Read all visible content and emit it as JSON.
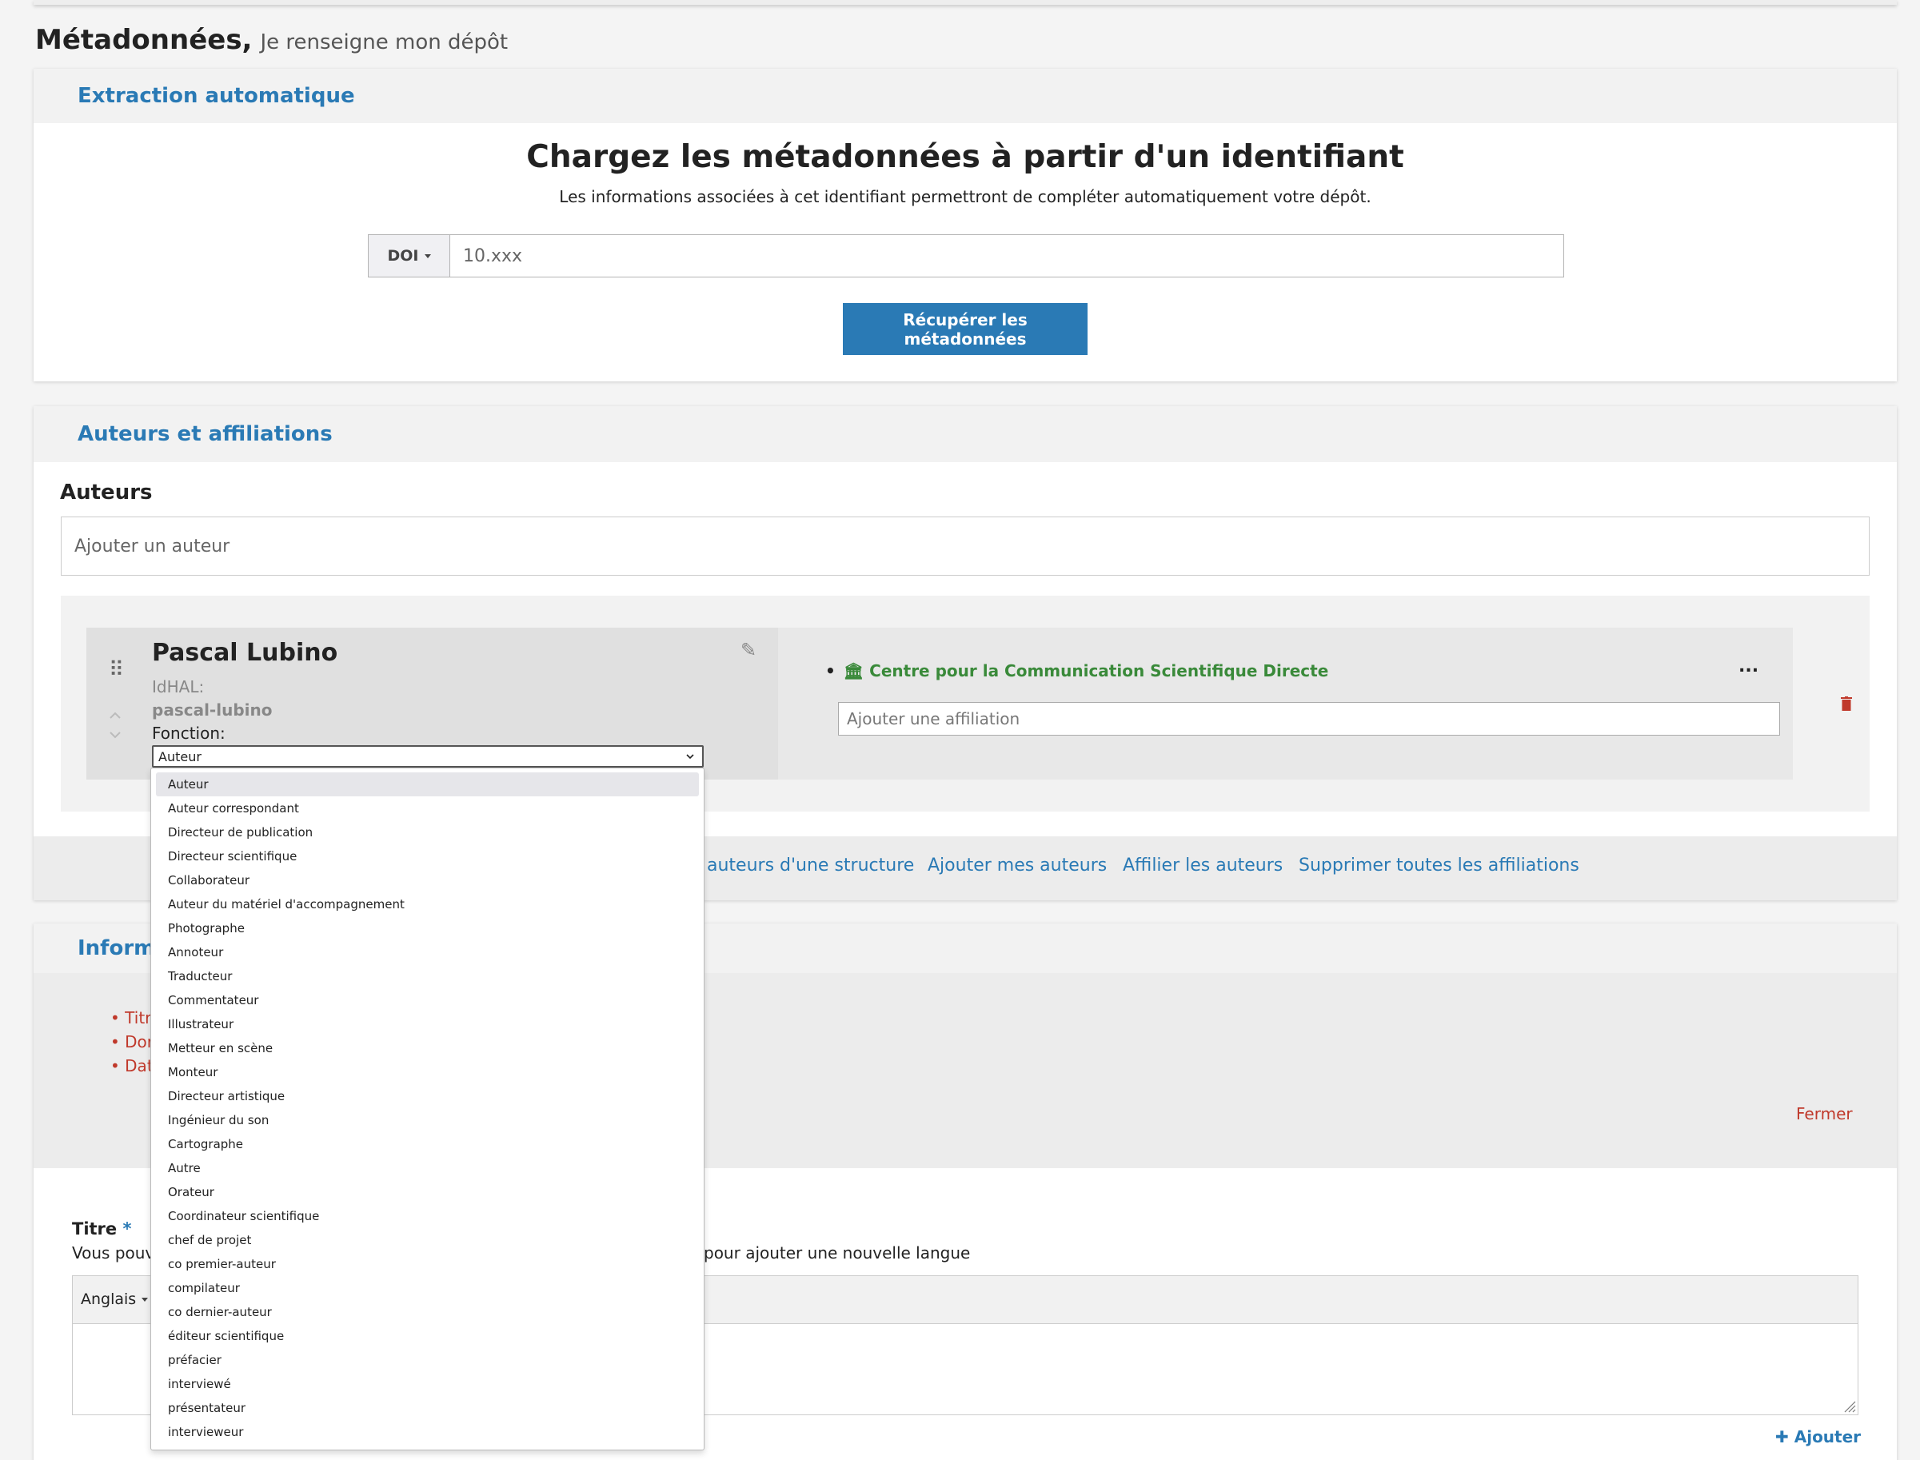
{
  "page": {
    "title": "Métadonnées,",
    "subtitle": "Je renseigne mon dépôt"
  },
  "extraction": {
    "header": "Extraction automatique",
    "title": "Chargez les métadonnées à partir d'un identifiant",
    "description": "Les informations associées à cet identifiant permettront de compléter automatiquement votre dépôt.",
    "id_type": "DOI",
    "placeholder": "10.xxx",
    "button": "Récupérer les métadonnées"
  },
  "authors": {
    "header": "Auteurs et affiliations",
    "label": "Auteurs",
    "add_placeholder": "Ajouter un auteur",
    "author": {
      "name": "Pascal Lubino",
      "idhal_label": "IdHAL:",
      "idhal_value": "pascal-lubino",
      "function_label": "Fonction:",
      "function_value": "Auteur",
      "affiliation": "Centre pour la Communication Scientifique Directe",
      "more": "...",
      "affiliation_placeholder": "Ajouter une affiliation"
    },
    "footer_links": [
      "auteurs d'une structure",
      "Ajouter mes auteurs",
      "Affilier les auteurs",
      "Supprimer toutes les affiliations"
    ]
  },
  "info": {
    "header": "Informa",
    "alerts": [
      "Titr",
      "Dor",
      "Dat"
    ],
    "close": "Fermer",
    "titre_label": "Titre",
    "titre_required": "*",
    "titre_desc": "Vous pouv",
    "titre_desc2": "pour ajouter une nouvelle langue",
    "lang": "Anglais",
    "add": "Ajouter"
  },
  "function_options": [
    "Auteur",
    "Auteur correspondant",
    "Directeur de publication",
    "Directeur scientifique",
    "Collaborateur",
    "Auteur du matériel d'accompagnement",
    "Photographe",
    "Annoteur",
    "Traducteur",
    "Commentateur",
    "Illustrateur",
    "Metteur en scène",
    "Monteur",
    "Directeur artistique",
    "Ingénieur du son",
    "Cartographe",
    "Autre",
    "Orateur",
    "Coordinateur scientifique",
    "chef de projet",
    "co premier-auteur",
    "compilateur",
    "co dernier-auteur",
    "éditeur scientifique",
    "préfacier",
    "interviewé",
    "présentateur",
    "intervieweur"
  ],
  "colors": {
    "accent": "#2a7ab5",
    "affiliation": "#3a8a3a",
    "danger": "#c0392b"
  }
}
